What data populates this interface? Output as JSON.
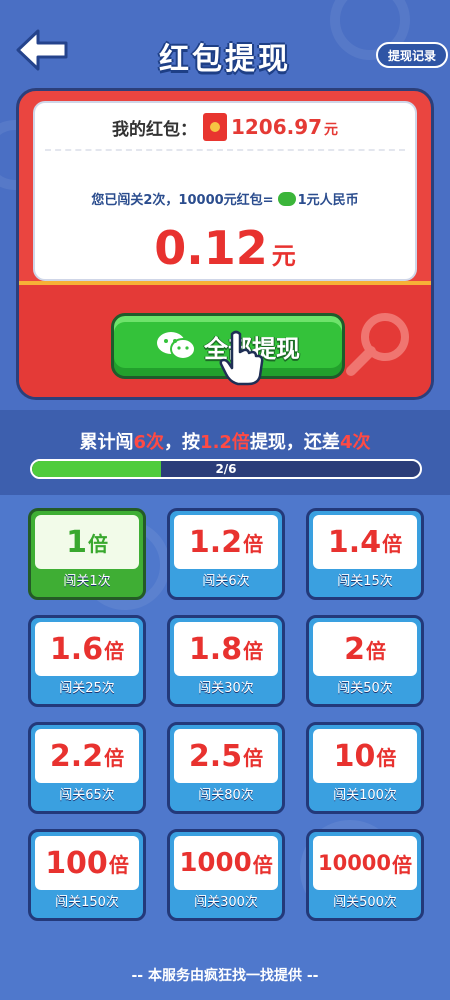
{
  "header": {
    "title": "红包提现",
    "record_label": "提现记录"
  },
  "balance": {
    "label": "我的红包：",
    "value": "1206.97",
    "unit": "元"
  },
  "passed": {
    "text_before": "您已闯关2次，10000元红包=",
    "text_after": "1元人民币"
  },
  "amount": {
    "value": "0.12",
    "unit": "元"
  },
  "withdraw_button": {
    "label": "全部提现"
  },
  "progress": {
    "part1": "累计闯",
    "count": "6次",
    "part2": "，按",
    "rate": "1.2倍",
    "part3": "提现，还差",
    "remaining": "4次",
    "label": "2/6",
    "fraction": 0.333
  },
  "tiers": [
    {
      "mult": "1",
      "bei": "倍",
      "foot": "闯关1次",
      "active": true
    },
    {
      "mult": "1.2",
      "bei": "倍",
      "foot": "闯关6次",
      "active": false
    },
    {
      "mult": "1.4",
      "bei": "倍",
      "foot": "闯关15次",
      "active": false
    },
    {
      "mult": "1.6",
      "bei": "倍",
      "foot": "闯关25次",
      "active": false
    },
    {
      "mult": "1.8",
      "bei": "倍",
      "foot": "闯关30次",
      "active": false
    },
    {
      "mult": "2",
      "bei": "倍",
      "foot": "闯关50次",
      "active": false
    },
    {
      "mult": "2.2",
      "bei": "倍",
      "foot": "闯关65次",
      "active": false
    },
    {
      "mult": "2.5",
      "bei": "倍",
      "foot": "闯关80次",
      "active": false
    },
    {
      "mult": "10",
      "bei": "倍",
      "foot": "闯关100次",
      "active": false
    },
    {
      "mult": "100",
      "bei": "倍",
      "foot": "闯关150次",
      "active": false
    },
    {
      "mult": "1000",
      "bei": "倍",
      "foot": "闯关300次",
      "active": false
    },
    {
      "mult": "10000",
      "bei": "倍",
      "foot": "闯关500次",
      "active": false
    }
  ],
  "footer": {
    "text": "-- 本服务由疯狂找一找提供 --"
  },
  "icons": {
    "back": "back-arrow-icon",
    "redpack": "red-envelope-icon",
    "wechat": "wechat-icon",
    "hand": "pointing-hand-icon"
  },
  "colors": {
    "accent_red": "#e8322f",
    "progress_green": "#4fcc3c",
    "button_green": "#34c23a",
    "background_blue": "#4a73c8"
  }
}
